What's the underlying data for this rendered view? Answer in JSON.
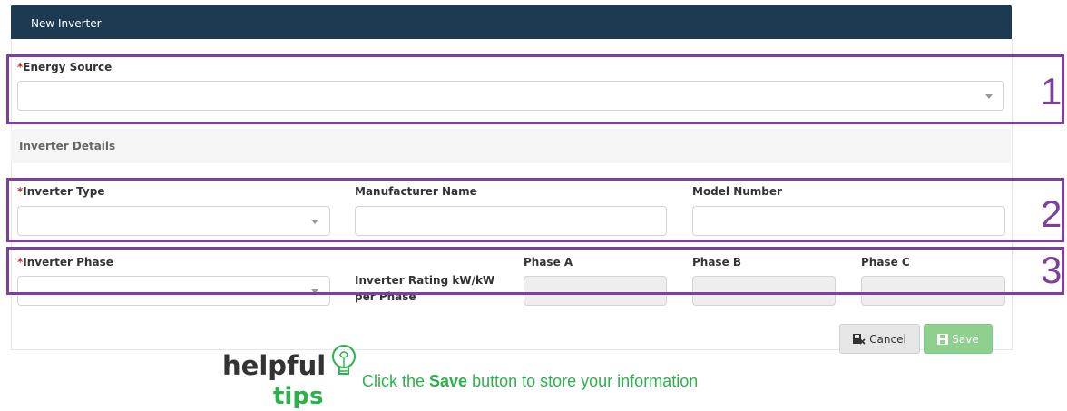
{
  "panel": {
    "title": "New Inverter"
  },
  "energy_source": {
    "required_mark": "*",
    "label": "Energy Source",
    "value": ""
  },
  "inverter_details": {
    "title": "Inverter Details"
  },
  "inverter_type": {
    "required_mark": "*",
    "label": "Inverter Type",
    "value": ""
  },
  "manufacturer": {
    "label": "Manufacturer Name",
    "value": ""
  },
  "model": {
    "label": "Model Number",
    "value": ""
  },
  "inverter_phase": {
    "required_mark": "*",
    "label": "Inverter Phase",
    "value": ""
  },
  "rating": {
    "label_line1": "Inverter Rating kW/kW",
    "label_line2": "per Phase"
  },
  "phase_a": {
    "label": "Phase A",
    "value": ""
  },
  "phase_b": {
    "label": "Phase B",
    "value": ""
  },
  "phase_c": {
    "label": "Phase C",
    "value": ""
  },
  "buttons": {
    "cancel": "Cancel",
    "save": "Save"
  },
  "callouts": [
    "1",
    "2",
    "3"
  ],
  "tips": {
    "logo_word1": "helpful",
    "logo_word2": "tips",
    "text_before": "Click the ",
    "text_bold": "Save",
    "text_after": " button to store your information"
  },
  "colors": {
    "header": "#1c3a52",
    "highlight": "#7e3fa0",
    "save": "#8ed08e",
    "tip": "#2bb24c",
    "required": "#c0392b"
  }
}
